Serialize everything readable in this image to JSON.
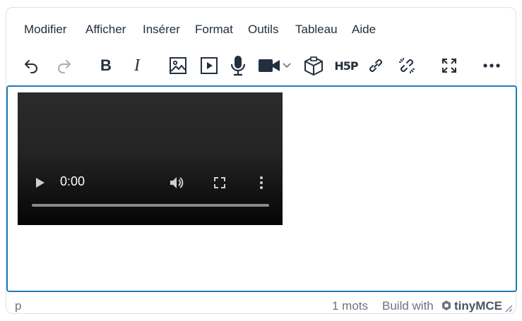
{
  "menubar": {
    "items": [
      "Modifier",
      "Afficher",
      "Insérer",
      "Format",
      "Outils",
      "Tableau",
      "Aide"
    ]
  },
  "toolbar": {
    "icons": [
      "undo-icon",
      "redo-icon",
      "bold-icon",
      "italic-icon",
      "image-icon",
      "media-icon",
      "microphone-icon",
      "video-camera-icon",
      "chevron-down-icon",
      "package-icon",
      "h5p-icon",
      "link-icon",
      "unlink-icon",
      "fullscreen-icon",
      "more-icon"
    ],
    "h5p_label": "H5P",
    "bold_label": "B",
    "italic_label": "I"
  },
  "content": {
    "video": {
      "time": "0:00"
    }
  },
  "statusbar": {
    "element_path": "p",
    "word_count": "1 mots",
    "branding_prefix": "Build with",
    "branding_name": "tinyMCE"
  },
  "colors": {
    "text": "#222f3e",
    "focus_border": "#207ab7",
    "muted": "#6b7280",
    "disabled_icon": "#a9aeb4"
  }
}
